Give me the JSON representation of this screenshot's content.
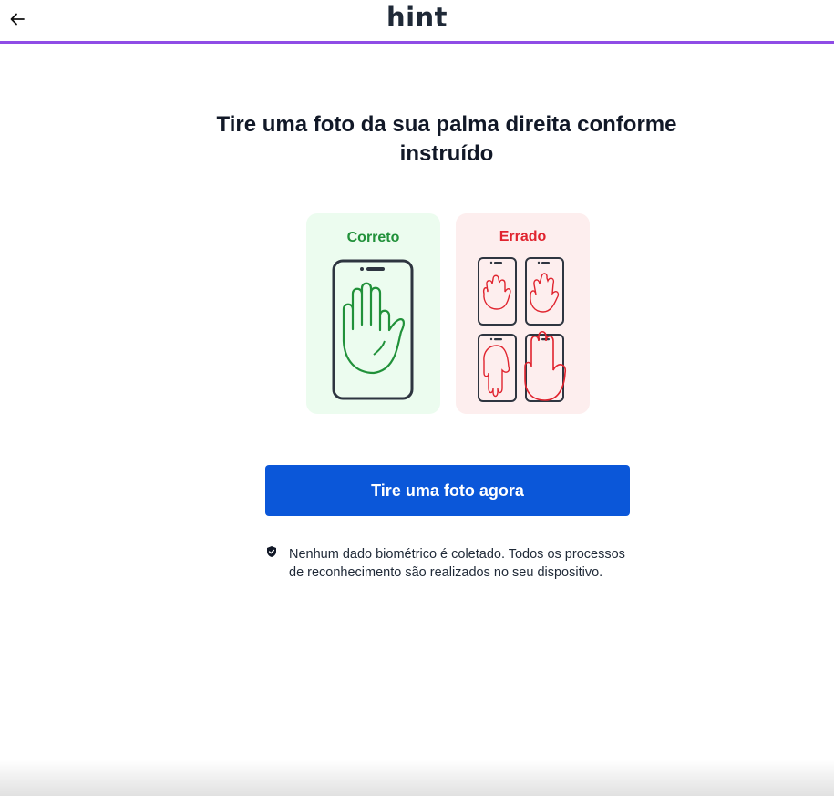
{
  "header": {
    "logo_text": "hint",
    "back_icon": "arrow-left-icon",
    "accent_color": "#8f4ce6"
  },
  "main": {
    "title": "Tire uma foto da sua palma direita conforme instruído",
    "correct_card": {
      "label": "Correto",
      "color": "#21913a",
      "background": "#ecfcef",
      "icon": "phone-palm-icon"
    },
    "wrong_card": {
      "label": "Errado",
      "color": "#e0242f",
      "background": "#fdeeee",
      "icons": [
        "phone-palm-tilted-left-icon",
        "phone-palm-tilted-right-icon",
        "phone-palm-upside-down-icon",
        "phone-palm-too-close-icon"
      ]
    },
    "primary_button": {
      "label": "Tire uma foto agora",
      "color": "#0b57d9"
    },
    "privacy": {
      "icon": "shield-check-icon",
      "text": "Nenhum dado biométrico é coletado. Todos os processos de reconhecimento são realizados no seu dispositivo."
    }
  }
}
